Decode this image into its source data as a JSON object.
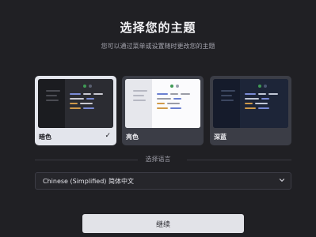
{
  "header": {
    "title": "选择您的主题",
    "subtitle": "您可以通过菜单或设置随时更改您的主题"
  },
  "themes": [
    {
      "label": "暗色",
      "selected": true
    },
    {
      "label": "亮色",
      "selected": false
    },
    {
      "label": "深蓝",
      "selected": false
    }
  ],
  "check_glyph": "✓",
  "language": {
    "section_label": "选择语言",
    "selected_value": "Chinese (Simplified) 简体中文"
  },
  "continue_label": "继续",
  "colors": {
    "background": "#202024",
    "selected_card": "#e3e5ec",
    "card": "#3b3d46",
    "button": "#e2e3e8"
  },
  "icons": {
    "check": "check-icon",
    "dropdown": "chevron-down-icon"
  }
}
